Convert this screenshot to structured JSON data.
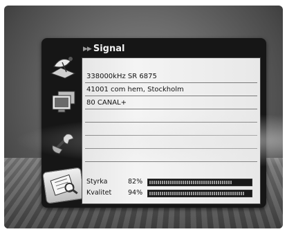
{
  "window": {
    "title": "Signal"
  },
  "info_rows": [
    "338000kHz SR 6875",
    "41001 com hem, Stockholm",
    "80 CANAL+",
    "",
    "",
    "",
    ""
  ],
  "meters": [
    {
      "label": "Styrka",
      "value_text": "82%",
      "level": 0.82
    },
    {
      "label": "Kvalitet",
      "value_text": "94%",
      "level": 0.94
    }
  ],
  "sidebar_icons": [
    {
      "name": "satellite-dish-icon",
      "active": false
    },
    {
      "name": "monitor-tv-icon",
      "active": false
    },
    {
      "name": "tools-icon",
      "active": false
    },
    {
      "name": "signal-info-icon",
      "active": true
    }
  ]
}
